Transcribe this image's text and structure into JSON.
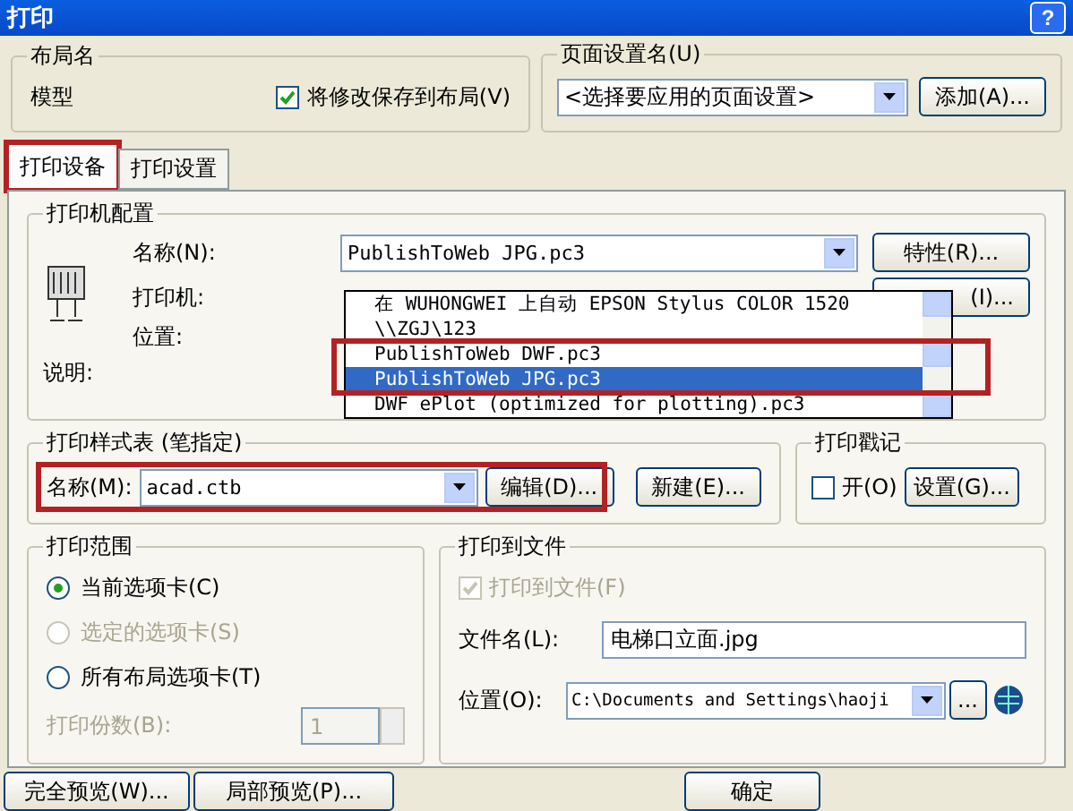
{
  "window": {
    "title": "打印",
    "help": "?"
  },
  "layout_name": {
    "legend": "布局名",
    "value": "模型",
    "save_changes": {
      "label": "将修改保存到布局(V)",
      "checked": true
    }
  },
  "page_setup": {
    "legend": "页面设置名(U)",
    "value": "<选择要应用的页面设置>",
    "add_button": "添加(A)..."
  },
  "tabs": [
    {
      "label": "打印设备",
      "selected": true,
      "highlighted": true
    },
    {
      "label": "打印设置",
      "selected": false,
      "highlighted": false
    }
  ],
  "printer_config": {
    "legend": "打印机配置",
    "name_label": "名称(N):",
    "name_value": "PublishToWeb JPG.pc3",
    "properties_button": "特性(R)...",
    "second_button": "(I)...",
    "printer_label": "打印机:",
    "location_label": "位置:",
    "description_label": "说明:",
    "dropdown_items": [
      {
        "label": "在 WUHONGWEI 上自动 EPSON Stylus COLOR 1520",
        "selected": false,
        "highlighted": false
      },
      {
        "label": "\\\\ZGJ\\123",
        "selected": false,
        "highlighted": false
      },
      {
        "label": "PublishToWeb DWF.pc3",
        "selected": false,
        "highlighted": true
      },
      {
        "label": "PublishToWeb JPG.pc3",
        "selected": true,
        "highlighted": true
      },
      {
        "label": "DWF ePlot (optimized for plotting).pc3",
        "selected": false,
        "highlighted": false
      }
    ]
  },
  "plot_style": {
    "legend": "打印样式表 (笔指定)",
    "name_label": "名称(M):",
    "value": "acad.ctb",
    "edit_button": "编辑(D)...",
    "new_button": "新建(E)...",
    "highlighted": true
  },
  "plot_stamp": {
    "legend": "打印戳记",
    "on": {
      "label": "开(O)",
      "checked": false
    },
    "settings_button": "设置(G)..."
  },
  "plot_range": {
    "legend": "打印范围",
    "options": [
      {
        "label": "当前选项卡(C)",
        "selected": true,
        "disabled": false
      },
      {
        "label": "选定的选项卡(S)",
        "selected": false,
        "disabled": true
      },
      {
        "label": "所有布局选项卡(T)",
        "selected": false,
        "disabled": false
      }
    ],
    "copies_label": "打印份数(B):",
    "copies_value": "1"
  },
  "plot_to_file": {
    "legend": "打印到文件",
    "print_to_file": {
      "label": "打印到文件(F)",
      "checked": true,
      "disabled": true
    },
    "file_name_label": "文件名(L):",
    "file_name": "电梯口立面.jpg",
    "location_label": "位置(O):",
    "location": "C:\\Documents and Settings\\haoji",
    "browse_button": "..."
  },
  "buttons": [
    "完全预览(W)...",
    "局部预览(P)...",
    "确定"
  ]
}
